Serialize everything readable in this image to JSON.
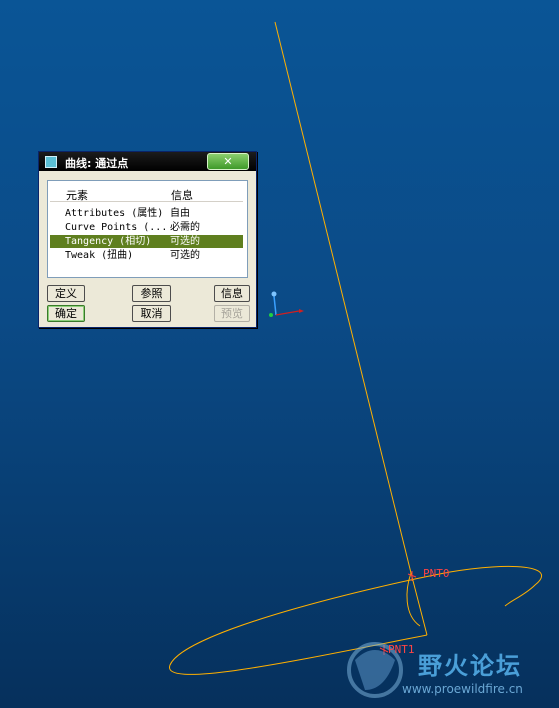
{
  "dialog": {
    "title": "曲线: 通过点",
    "close_label": "✕",
    "list": {
      "headers": [
        "元素",
        "信息"
      ],
      "rows": [
        {
          "element": "Attributes (属性)",
          "info": "自由"
        },
        {
          "element": "Curve Points (...",
          "info": "必需的"
        },
        {
          "element": "Tangency (相切)",
          "info": "可选的"
        },
        {
          "element": "Tweak (扭曲)",
          "info": "可选的"
        }
      ],
      "selected_index": 2
    },
    "buttons": {
      "define": "定义",
      "reference": "参照",
      "info": "信息",
      "ok": "确定",
      "cancel": "取消",
      "preview": "预览"
    }
  },
  "canvas": {
    "point_labels": [
      "PNT0",
      "PNT1"
    ],
    "curve_color": "#ffb000",
    "point_color": "#ff3b3b"
  },
  "watermark": {
    "brand": "野火论坛",
    "url": "www.proewildfire.cn"
  },
  "colors": {
    "background": "#0b4a86",
    "selection": "#5f7f1f"
  }
}
